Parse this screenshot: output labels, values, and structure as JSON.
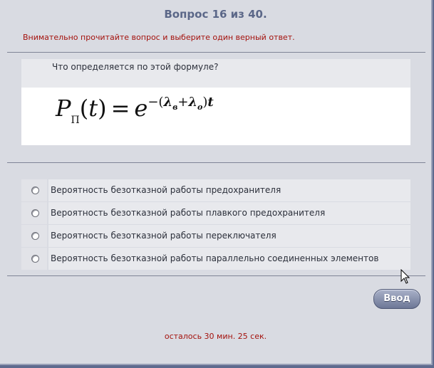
{
  "header": {
    "title": "Вопрос 16 из 40.",
    "instruction": "Внимательно прочитайте вопрос и выберите один верный ответ."
  },
  "question": {
    "text": "Что определяется по этой формуле?",
    "formula": {
      "lhs": "P",
      "lhs_sub": "П",
      "arg": "t",
      "equals": "=",
      "base": "e",
      "exp_sign": "−",
      "lambda1": "λ",
      "lambda1_sub": "в",
      "plus": "+",
      "lambda2": "λ",
      "lambda2_sub": "о",
      "exp_var": "t"
    }
  },
  "answers": [
    {
      "label": "Вероятность безотказной работы предохранителя",
      "selected": false
    },
    {
      "label": "Вероятность безотказной работы плавкого предохранителя",
      "selected": false
    },
    {
      "label": "Вероятность безотказной работы переключателя",
      "selected": false
    },
    {
      "label": "Вероятность безотказной работы параллельно соединенных элементов",
      "selected": false
    }
  ],
  "submit": {
    "label": "Ввод"
  },
  "timer": {
    "text": "осталось 30 мин. 25 сек."
  }
}
